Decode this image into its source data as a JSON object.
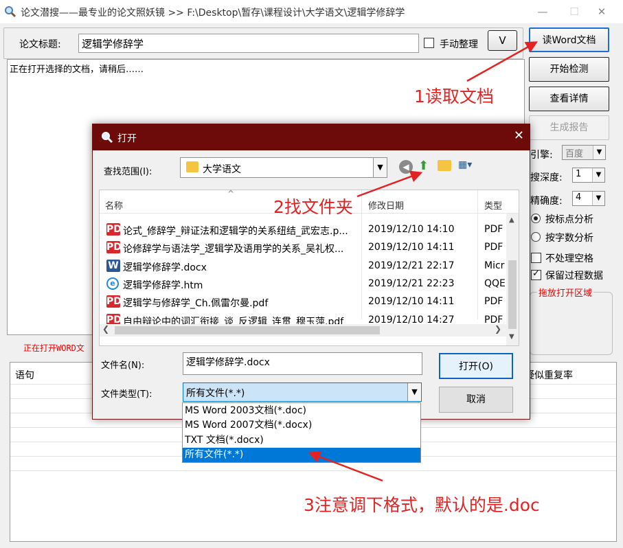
{
  "window": {
    "title": "论文潜搜——最专业的论文照妖镜 >> F:\\Desktop\\暂存\\课程设计\\大学语文\\逻辑学修辞学",
    "min": "—",
    "max": "☐",
    "close": "✕"
  },
  "header": {
    "title_label": "论文标题:",
    "title_value": "逻辑学修辞学",
    "manual_label": "手动整理",
    "expand_button": "V"
  },
  "main": {
    "status": "正在打开选择的文档，请稍后……",
    "opening_status": "正在打开WORD文"
  },
  "sidebar": {
    "read_word": "读Word文档",
    "start_check": "开始检测",
    "view_details": "查看详情",
    "gen_report": "生成报告",
    "engine_label": "引擎:",
    "engine_value": "百度",
    "depth_label": "搜深度:",
    "depth_value": "1",
    "precision_label": "精确度:",
    "precision_value": "4",
    "radio_punct": "按标点分析",
    "radio_chars": "按字数分析",
    "no_space": "不处理空格",
    "keep_data": "保留过程数据",
    "drop_area": "拖放打开区域"
  },
  "results": {
    "col_sentence": "语句",
    "col_rate": "疑似重复率"
  },
  "dialog": {
    "title": "打开",
    "lookin_label": "查找范围(I):",
    "lookin_value": "大学语文",
    "columns": {
      "name": "名称",
      "date": "修改日期",
      "type": "类型"
    },
    "files": [
      {
        "name": "论式_修辞学_辩证法和逻辑学的关系纽结_武宏志.p...",
        "date": "2019/12/10 14:10",
        "type": "PDF",
        "icon": "pdf"
      },
      {
        "name": "论修辞学与语法学_逻辑学及语用学的关系_吴礼权...",
        "date": "2019/12/10 14:11",
        "type": "PDF",
        "icon": "pdf"
      },
      {
        "name": "逻辑学修辞学.docx",
        "date": "2019/12/21 22:17",
        "type": "Micr",
        "icon": "docx"
      },
      {
        "name": "逻辑学修辞学.htm",
        "date": "2019/12/21 22:23",
        "type": "QQE",
        "icon": "htm"
      },
      {
        "name": "逻辑学与修辞学_Ch.佩雷尔曼.pdf",
        "date": "2019/12/10 14:11",
        "type": "PDF",
        "icon": "pdf"
      },
      {
        "name": "自由辩论中的词汇衔接_谈_反逻辑_连贯_穆玉萍.pdf",
        "date": "2019/12/10 14:27",
        "type": "PDF",
        "icon": "pdf"
      }
    ],
    "filename_label": "文件名(N):",
    "filename_value": "逻辑学修辞学.docx",
    "filetype_label": "文件类型(T):",
    "filetype_value": "所有文件(*.*)",
    "open_button": "打开(O)",
    "cancel_button": "取消",
    "filetype_options": [
      "MS Word 2003文档(*.doc)",
      "MS Word 2007文档(*.docx)",
      "TXT 文档(*.docx)",
      "所有文件(*.*)"
    ],
    "selected_option_index": 3
  },
  "annotations": {
    "step1": "1读取文档",
    "step2": "2找文件夹",
    "step3": "3注意调下格式，默认的是.doc"
  },
  "colors": {
    "accent_dialog": "#6d0b0b",
    "annotation": "#e52222",
    "selection": "#0078d7"
  }
}
